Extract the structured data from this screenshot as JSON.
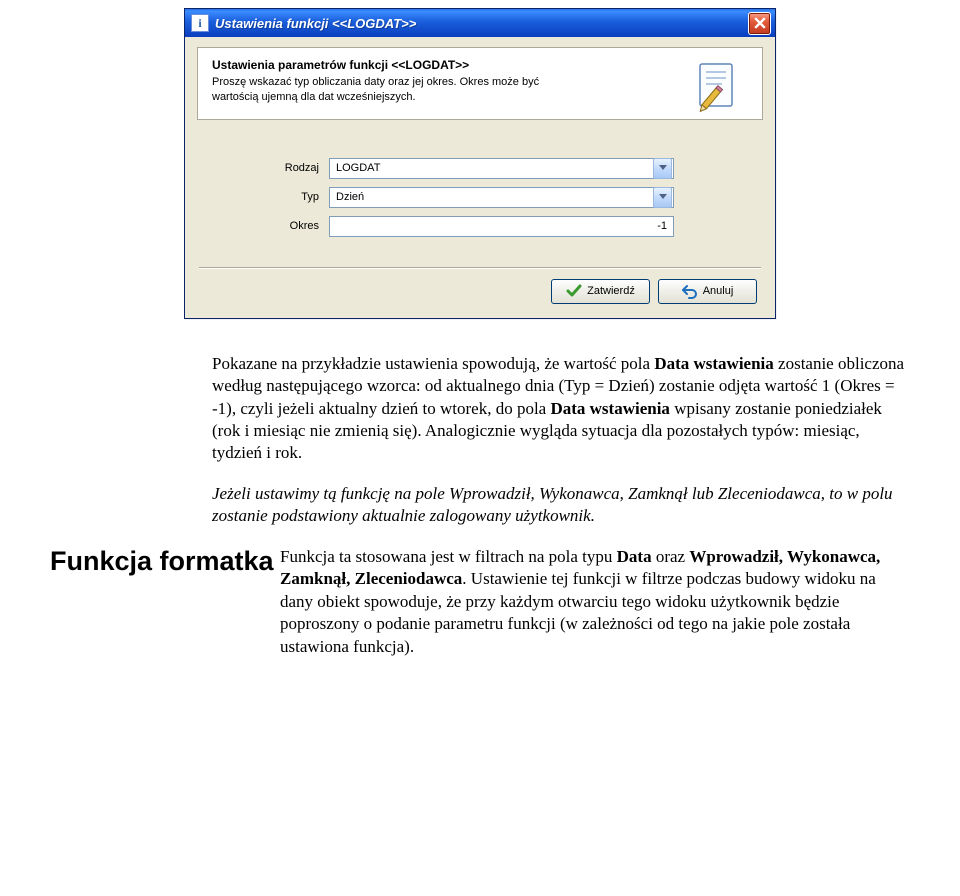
{
  "dialog": {
    "title": "Ustawienia funkcji <<LOGDAT>>",
    "header_title": "Ustawienia parametrów funkcji <<LOGDAT>>",
    "header_desc": "Proszę wskazać typ obliczania daty oraz jej okres. Okres może być wartością ujemną dla dat wcześniejszych.",
    "fields": {
      "rodzaj": {
        "label": "Rodzaj",
        "value": "LOGDAT"
      },
      "typ": {
        "label": "Typ",
        "value": "Dzień"
      },
      "okres": {
        "label": "Okres",
        "value": "-1"
      }
    },
    "buttons": {
      "confirm": "Zatwierdź",
      "cancel": "Anuluj"
    }
  },
  "doc": {
    "para1_pre": "Pokazane na przykładzie ustawienia spowodują, że wartość pola ",
    "para1_b1": "Data wstawienia",
    "para1_mid1": " zostanie obliczona według następującego wzorca: od aktualnego dnia (Typ = Dzień) zostanie odjęta wartość 1 (Okres = -1), czyli jeżeli aktualny dzień to wtorek, do pola ",
    "para1_b2": "Data wstawienia",
    "para1_mid2": " wpisany zostanie poniedziałek (rok i miesiąc nie zmienią się). Analogicznie wygląda sytuacja dla pozostałych typów: miesiąc, tydzień i rok.",
    "para2": "Jeżeli ustawimy tą funkcję na pole Wprowadził, Wykonawca, Zamknął lub Zleceniodawca, to w polu zostanie podstawiony aktualnie zalogowany użytkownik.",
    "section_heading": "Funkcja formatka",
    "para3_pre": "Funkcja ta stosowana jest w filtrach na pola typu ",
    "para3_b1": "Data",
    "para3_mid": " oraz ",
    "para3_b2": "Wprowadził, Wykonawca, Zamknął, Zleceniodawca",
    "para3_post": ". Ustawienie tej funkcji w filtrze podczas budowy widoku na dany obiekt spowoduje, że przy każdym otwarciu tego widoku użytkownik będzie poproszony o podanie parametru funkcji (w zależności od tego na jakie pole została ustawiona funkcja)."
  }
}
